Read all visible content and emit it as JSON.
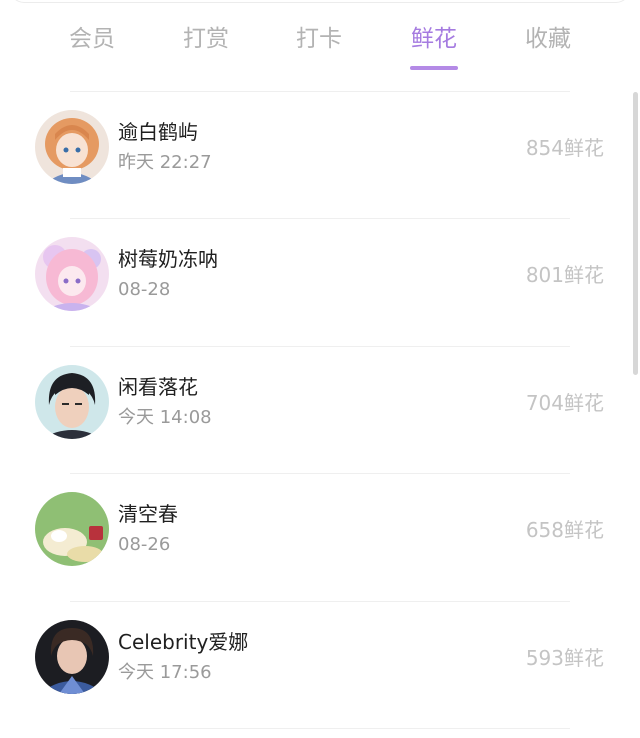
{
  "tabs": [
    {
      "label": "会员",
      "active": false
    },
    {
      "label": "打赏",
      "active": false
    },
    {
      "label": "打卡",
      "active": false
    },
    {
      "label": "鲜花",
      "active": true
    },
    {
      "label": "收藏",
      "active": false
    }
  ],
  "colors": {
    "accent": "#a57be0",
    "tab_inactive": "#b3b3b3",
    "secondary_text": "#9a9a9a",
    "count_text": "#c4c4c4"
  },
  "list": [
    {
      "name": "逾白鹤屿",
      "time": "昨天 22:27",
      "flowers": "854鲜花",
      "avatar": "anime-girl-orange-hair-avatar"
    },
    {
      "name": "树莓奶冻呐",
      "time": "08-28",
      "flowers": "801鲜花",
      "avatar": "anime-girl-pink-hair-avatar"
    },
    {
      "name": "闲看落花",
      "time": "今天 14:08",
      "flowers": "704鲜花",
      "avatar": "young-man-photo-avatar"
    },
    {
      "name": "清空春",
      "time": "08-26",
      "flowers": "658鲜花",
      "avatar": "green-illustration-avatar"
    },
    {
      "name": "Celebrity爱娜",
      "time": "今天 17:56",
      "flowers": "593鲜花",
      "avatar": "man-blue-jacket-photo-avatar"
    }
  ]
}
